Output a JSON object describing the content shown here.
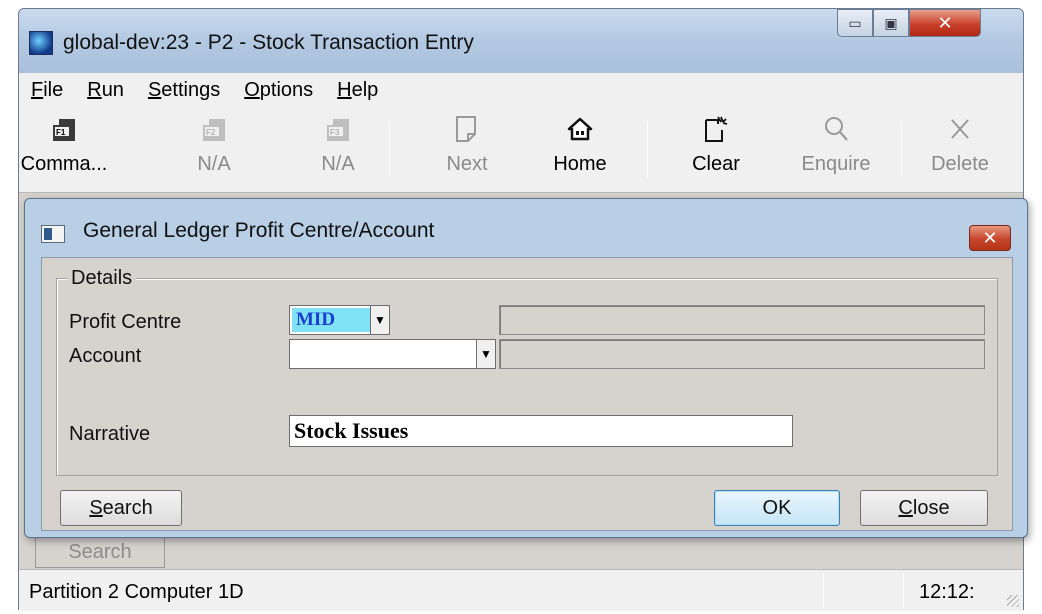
{
  "window": {
    "title": "global-dev:23 - P2 - Stock Transaction Entry",
    "minimize_glyph": "▭",
    "maximize_glyph": "▣",
    "close_glyph": "✕"
  },
  "menu": [
    {
      "label": "File",
      "mnemonic": "F",
      "rest": "ile"
    },
    {
      "label": "Run",
      "mnemonic": "R",
      "rest": "un"
    },
    {
      "label": "Settings",
      "mnemonic": "S",
      "rest": "ettings"
    },
    {
      "label": "Options",
      "mnemonic": "O",
      "rest": "ptions"
    },
    {
      "label": "Help",
      "mnemonic": "H",
      "rest": "elp"
    }
  ],
  "toolbar": {
    "command": {
      "label": "Comma...",
      "icon": "f1-icon",
      "key": "F1"
    },
    "f2": {
      "label": "N/A",
      "icon": "f2-icon",
      "key": "F2"
    },
    "f3": {
      "label": "N/A",
      "icon": "f3-icon",
      "key": "F3"
    },
    "next": {
      "label": "Next",
      "icon": "next-page-icon"
    },
    "home": {
      "label": "Home",
      "icon": "home-icon"
    },
    "clear": {
      "label": "Clear",
      "icon": "clear-icon"
    },
    "enquire": {
      "label": "Enquire",
      "icon": "magnifier-icon"
    },
    "delete": {
      "label": "Delete",
      "icon": "delete-x-icon"
    }
  },
  "dialog": {
    "title": "General Ledger Profit Centre/Account",
    "close_glyph": "✕",
    "group_label": "Details",
    "profit_centre": {
      "label": "Profit Centre",
      "value": "MID",
      "description": ""
    },
    "account": {
      "label": "Account",
      "value": "",
      "description": ""
    },
    "narrative": {
      "label": "Narrative",
      "value": "Stock Issues"
    },
    "buttons": {
      "search": {
        "label": "Search",
        "mnemonic": "S",
        "rest": "earch"
      },
      "ok": {
        "label": "OK"
      },
      "close": {
        "label": "Close",
        "mnemonic": "C",
        "rest": "lose"
      }
    },
    "dropdown_glyph": "▼"
  },
  "background": {
    "search_button": "Search"
  },
  "statusbar": {
    "left": "Partition 2 Computer 1D",
    "time": "12:12:"
  },
  "colors": {
    "selection_bg": "#7fe3f5",
    "selection_fg": "#1a3fd0",
    "dialog_frame": "#b8cfe6"
  }
}
